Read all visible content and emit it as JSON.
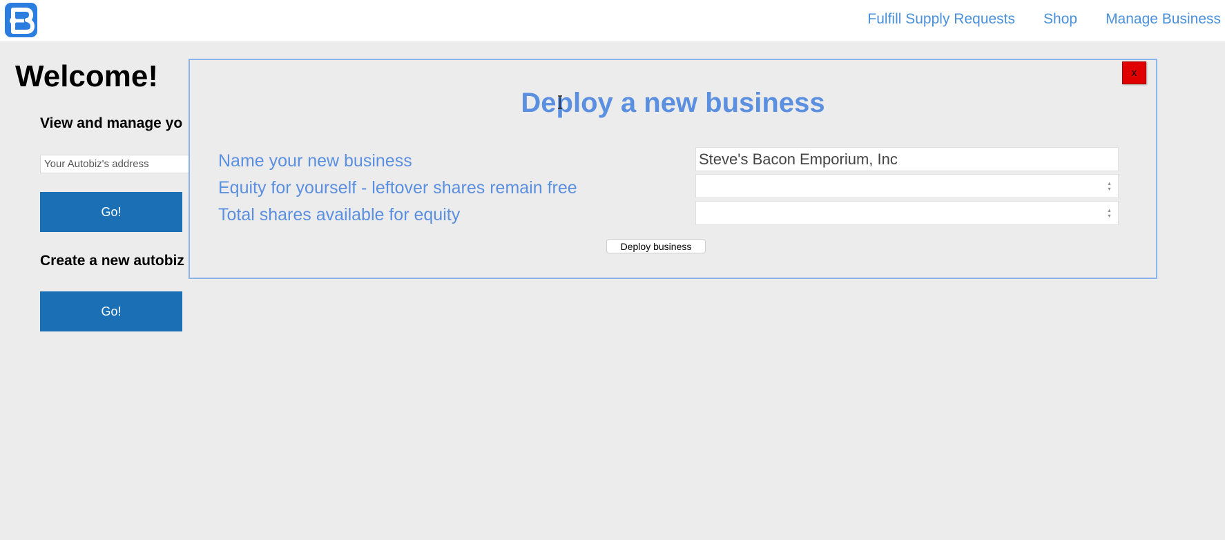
{
  "nav": {
    "logo_icon": "autobiz-logo-icon",
    "links": [
      "Fulfill Supply Requests",
      "Shop",
      "Manage Business"
    ]
  },
  "main": {
    "welcome": "Welcome!",
    "view_manage_heading": "View and manage yo",
    "address_placeholder": "Your Autobiz's address",
    "go_label_1": "Go!",
    "create_heading": "Create a new autobiz",
    "go_label_2": "Go!"
  },
  "modal": {
    "title": "Deploy a new business",
    "close_label": "x",
    "fields": [
      {
        "label": "Name your new business",
        "value": "Steve's Bacon Emporium, Inc"
      },
      {
        "label": "Equity for yourself - leftover shares remain free",
        "value": ""
      },
      {
        "label": "Total shares available for equity",
        "value": ""
      }
    ],
    "deploy_label": "Deploy business"
  },
  "colors": {
    "accent": "#5b8fe0",
    "nav_link": "#4a90d9",
    "go_button": "#1a6fb5",
    "close_button": "#e00000",
    "logo": "#2b7de0"
  }
}
